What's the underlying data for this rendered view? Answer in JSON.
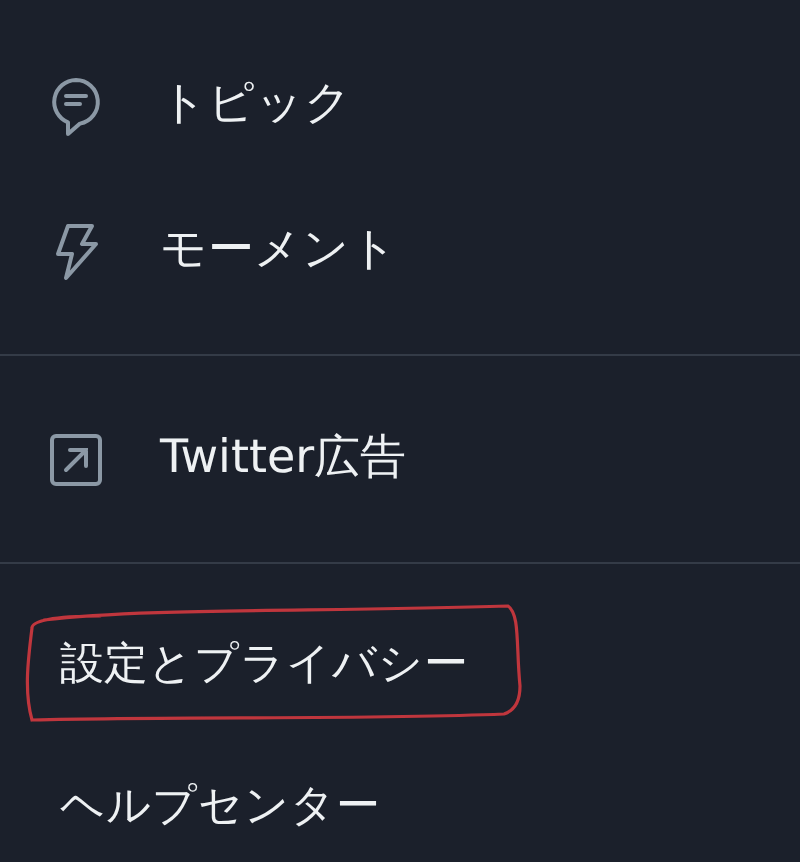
{
  "menu": [
    {
      "kind": "icon",
      "label": "トピック"
    },
    {
      "kind": "icon",
      "label": "モーメント"
    },
    {
      "kind": "divider"
    },
    {
      "kind": "icon",
      "label": "Twitter広告"
    },
    {
      "kind": "divider"
    },
    {
      "kind": "text",
      "label": "設定とプライバシー",
      "highlighted": true
    },
    {
      "kind": "text",
      "label": "ヘルプセンター",
      "highlighted": false
    }
  ]
}
